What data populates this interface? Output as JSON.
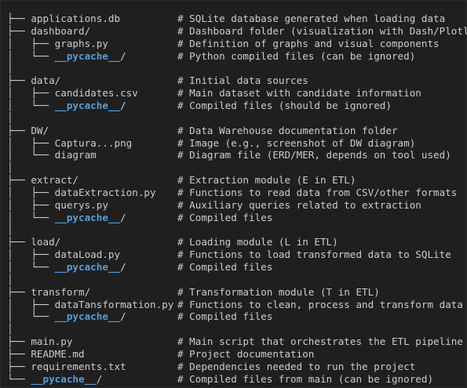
{
  "colors": {
    "background": "#1f1f1f",
    "text": "#cccccc",
    "pycache": "#569cd6"
  },
  "rows": [
    {
      "type": "entry",
      "tree": "├── ",
      "name": "applications.db",
      "comment": "# SQLite database generated when loading data",
      "pycache": false
    },
    {
      "type": "entry",
      "tree": "├── ",
      "name": "dashboard/",
      "comment": "# Dashboard folder (visualization with Dash/Plotly)",
      "pycache": false
    },
    {
      "type": "entry",
      "tree": "│   ├── ",
      "name": "graphs.py",
      "comment": "# Definition of graphs and visual components",
      "pycache": false
    },
    {
      "type": "entry",
      "tree": "│   └── ",
      "name": "__pycache__",
      "suffix": "/",
      "comment": "# Python compiled files (can be ignored)",
      "pycache": true
    },
    {
      "type": "blank",
      "tree": "│"
    },
    {
      "type": "entry",
      "tree": "├── ",
      "name": "data/",
      "comment": "# Initial data sources",
      "pycache": false
    },
    {
      "type": "entry",
      "tree": "│   ├── ",
      "name": "candidates.csv",
      "comment": "# Main dataset with candidate information",
      "pycache": false
    },
    {
      "type": "entry",
      "tree": "│   └── ",
      "name": "__pycache__",
      "suffix": "/",
      "comment": "# Compiled files (should be ignored)",
      "pycache": true
    },
    {
      "type": "blank",
      "tree": "│"
    },
    {
      "type": "entry",
      "tree": "├── ",
      "name": "DW/",
      "comment": "# Data Warehouse documentation folder",
      "pycache": false
    },
    {
      "type": "entry",
      "tree": "│   ├── ",
      "name": "Captura...png",
      "comment": "# Image (e.g., screenshot of DW diagram)",
      "pycache": false
    },
    {
      "type": "entry",
      "tree": "│   └── ",
      "name": "diagram",
      "comment": "# Diagram file (ERD/MER, depends on tool used)",
      "pycache": false
    },
    {
      "type": "blank",
      "tree": "│"
    },
    {
      "type": "entry",
      "tree": "├── ",
      "name": "extract/",
      "comment": "# Extraction module (E in ETL)",
      "pycache": false
    },
    {
      "type": "entry",
      "tree": "│   ├── ",
      "name": "dataExtraction.py",
      "comment": "# Functions to read data from CSV/other formats",
      "pycache": false
    },
    {
      "type": "entry",
      "tree": "│   ├── ",
      "name": "querys.py",
      "comment": "# Auxiliary queries related to extraction",
      "pycache": false
    },
    {
      "type": "entry",
      "tree": "│   └── ",
      "name": "__pycache__",
      "suffix": "/",
      "comment": "# Compiled files",
      "pycache": true
    },
    {
      "type": "blank",
      "tree": "│"
    },
    {
      "type": "entry",
      "tree": "├── ",
      "name": "load/",
      "comment": "# Loading module (L in ETL)",
      "pycache": false
    },
    {
      "type": "entry",
      "tree": "│   ├── ",
      "name": "dataLoad.py",
      "comment": "# Functions to load transformed data to SQLite",
      "pycache": false
    },
    {
      "type": "entry",
      "tree": "│   └── ",
      "name": "__pycache__",
      "suffix": "/",
      "comment": "# Compiled files",
      "pycache": true
    },
    {
      "type": "blank",
      "tree": "│"
    },
    {
      "type": "entry",
      "tree": "├── ",
      "name": "transform/",
      "comment": "# Transformation module (T in ETL)",
      "pycache": false
    },
    {
      "type": "entry",
      "tree": "│   ├── ",
      "name": "dataTansformation.py",
      "comment": "# Functions to clean, process and transform data",
      "pycache": false
    },
    {
      "type": "entry",
      "tree": "│   └── ",
      "name": "__pycache__",
      "suffix": "/",
      "comment": "# Compiled files",
      "pycache": true
    },
    {
      "type": "blank",
      "tree": "│"
    },
    {
      "type": "entry",
      "tree": "├── ",
      "name": "main.py",
      "comment": "# Main script that orchestrates the ETL pipeline",
      "pycache": false
    },
    {
      "type": "entry",
      "tree": "├── ",
      "name": "README.md",
      "comment": "# Project documentation",
      "pycache": false
    },
    {
      "type": "entry",
      "tree": "├── ",
      "name": "requirements.txt",
      "comment": "# Dependencies needed to run the project",
      "pycache": false
    },
    {
      "type": "entry",
      "tree": "└── ",
      "name": "__pycache__",
      "suffix": "/",
      "comment": "# Compiled files from main (can be ignored)",
      "pycache": true
    }
  ]
}
